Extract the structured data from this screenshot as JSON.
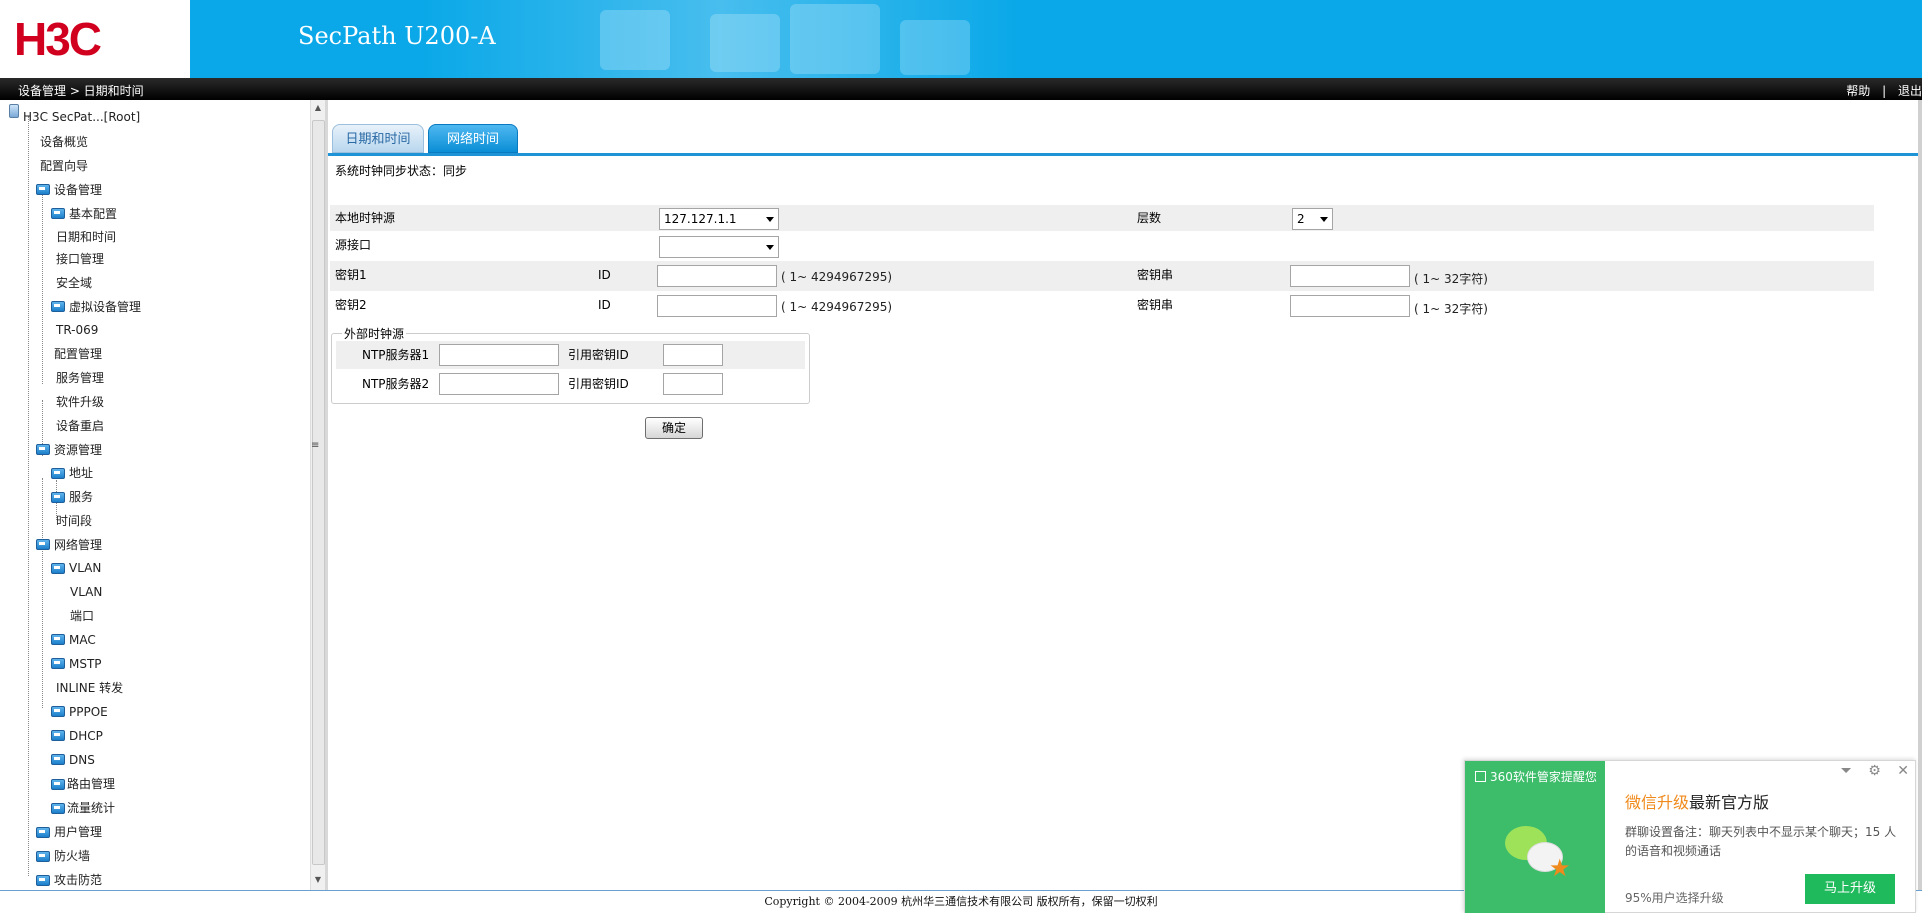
{
  "header": {
    "logo": "H3C",
    "product": "SecPath U200-A"
  },
  "topbar": {
    "breadcrumb": "设备管理 > 日期和时间",
    "help": "帮助",
    "separator": "|",
    "logout": "退出"
  },
  "sidebar": {
    "root": "H3C SecPat...[Root]",
    "items": [
      {
        "label": "设备概览"
      },
      {
        "label": "配置向导"
      },
      {
        "label": "设备管理"
      },
      {
        "label": "基本配置"
      },
      {
        "label": "日期和时间"
      },
      {
        "label": "接口管理"
      },
      {
        "label": "安全域"
      },
      {
        "label": "虚拟设备管理"
      },
      {
        "label": "TR-069"
      },
      {
        "label": "配置管理"
      },
      {
        "label": "服务管理"
      },
      {
        "label": "软件升级"
      },
      {
        "label": "设备重启"
      },
      {
        "label": "资源管理"
      },
      {
        "label": "地址"
      },
      {
        "label": "服务"
      },
      {
        "label": "时间段"
      },
      {
        "label": "网络管理"
      },
      {
        "label": "VLAN"
      },
      {
        "label": "VLAN"
      },
      {
        "label": "端口"
      },
      {
        "label": "MAC"
      },
      {
        "label": "MSTP"
      },
      {
        "label": "INLINE 转发"
      },
      {
        "label": "PPPOE"
      },
      {
        "label": "DHCP"
      },
      {
        "label": "DNS"
      },
      {
        "label": "路由管理"
      },
      {
        "label": "流量统计"
      },
      {
        "label": "用户管理"
      },
      {
        "label": "防火墙"
      },
      {
        "label": "攻击防范"
      }
    ]
  },
  "tabs": [
    {
      "label": "日期和时间"
    },
    {
      "label": "网络时间"
    }
  ],
  "form": {
    "sync_status": "系统时钟同步状态：同步",
    "local_clock_label": "本地时钟源",
    "local_clock_value": "127.127.1.1",
    "stratum_label": "层数",
    "stratum_value": "2",
    "source_if_label": "源接口",
    "source_if_value": "",
    "key1_label": "密钥1",
    "key2_label": "密钥2",
    "id_label": "ID",
    "id_hint": "( 1~ 4294967295)",
    "keystr_label": "密钥串",
    "keystr_hint": "( 1~ 32字符)",
    "external_legend": "外部时钟源",
    "ntp1_label": "NTP服务器1",
    "ntp2_label": "NTP服务器2",
    "ref_key_label": "引用密钥ID",
    "ok_button": "确定"
  },
  "footer": {
    "copyright": "Copyright © 2004-2009 杭州华三通信技术有限公司 版权所有，保留一切权利"
  },
  "popup": {
    "brand": "360软件管家提醒您",
    "title_highlight": "微信升级",
    "title_rest": "最新官方版",
    "desc": "群聊设置备注：聊天列表中不显示某个聊天；15 人的语音和视频通话",
    "footnote": "95%用户选择升级",
    "button": "马上升级"
  },
  "colors": {
    "header_blue": "#0aa8e8",
    "logo_red": "#d2001f",
    "tab_active": "#0a8ed6",
    "popup_green": "#3dbd6a"
  }
}
